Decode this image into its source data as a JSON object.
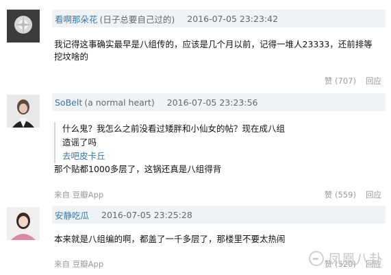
{
  "comments": [
    {
      "author": "看啊那朵花",
      "signature": "(日子总要自己过的)",
      "time": "2016-07-05 23:23:42",
      "text": "我记得这事确实最早是八组传的，应该是几个月以前，记得一堆人23333，还前排等挖坟啥的",
      "like_label": "赞 (707)",
      "reply_label": "回应"
    },
    {
      "author": "SoBelt",
      "signature": "(a normal heart)",
      "time": "2016-07-05 23:23:56",
      "quote_text": "什么鬼？我怎么之前没看过矮胖和小仙女的帖？现在成八组造谣了吗",
      "quote_author": "去吧皮卡丘",
      "text": "那个贴都1000多层了，这锅还真是八组得背",
      "source": "来自 豆瓣App",
      "like_label": "赞 (559)",
      "reply_label": "回应"
    },
    {
      "author": "安静吃瓜",
      "signature": "",
      "time": "2016-07-05 23:25:28",
      "text": "本来就是八组编的啊，都盖了一千多层了，那楼里不要太热闹",
      "source": "来自 豆瓣App",
      "like_label": "赞 (520)",
      "reply_label": "回应"
    }
  ],
  "watermark": "凤凰八卦",
  "colors": {
    "author": "#3377aa",
    "header_bg": "#f0f3f5",
    "meta": "#999999"
  }
}
